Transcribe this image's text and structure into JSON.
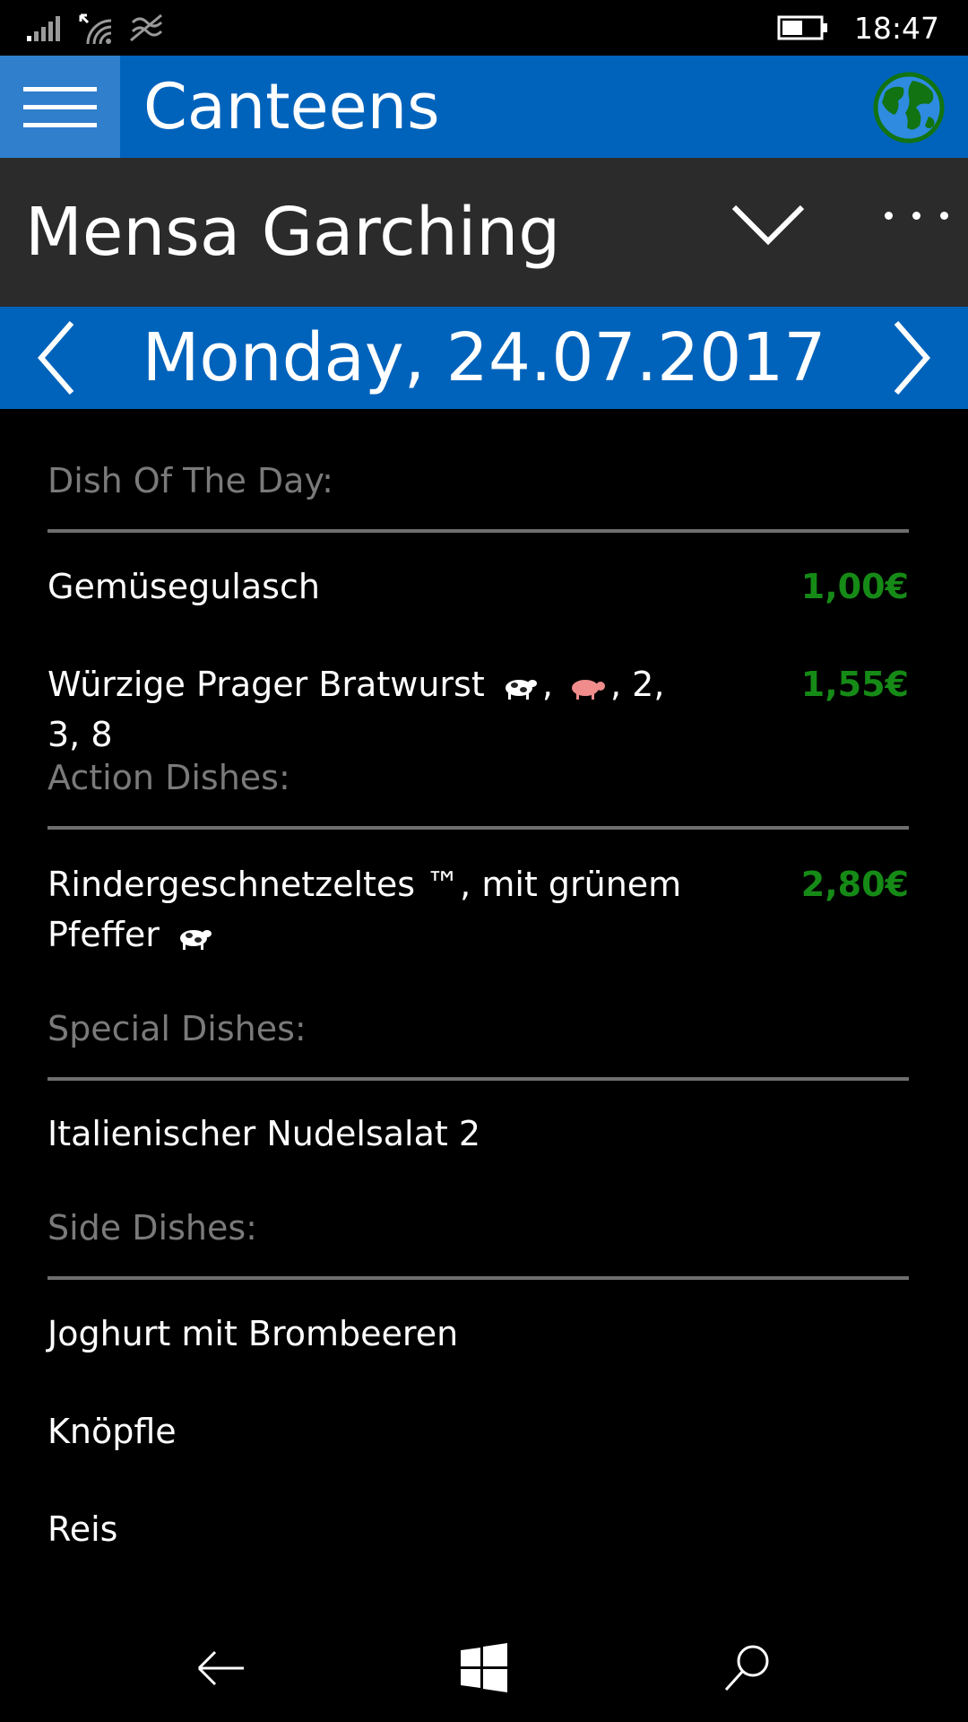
{
  "status_bar": {
    "time": "18:47",
    "icons": [
      "signal-icon",
      "wifi-icon",
      "data-icon",
      "battery-icon"
    ]
  },
  "app_bar": {
    "title": "Canteens",
    "menu_icon": "hamburger-icon",
    "action_icon": "globe-icon"
  },
  "canteen": {
    "name": "Mensa Garching"
  },
  "date_bar": {
    "date": "Monday, 24.07.2017"
  },
  "sections": [
    {
      "header": "Dish Of The Day:",
      "dishes": [
        {
          "name": "Gemüsegulasch",
          "price": "1,00€"
        },
        {
          "name": "Würzige Prager Bratwurst",
          "suffix": ", 2, 3, 8",
          "price": "1,55€"
        }
      ]
    },
    {
      "header": "Action Dishes:",
      "dishes": [
        {
          "name": "Rindergeschnetzeltes ™,  mit grünem Pfeffer",
          "price": "2,80€"
        }
      ]
    },
    {
      "header": "Special Dishes:",
      "dishes": [
        {
          "name": "Italienischer Nudelsalat 2"
        }
      ]
    },
    {
      "header": "Side Dishes:",
      "dishes": [
        {
          "name": "Joghurt mit Brombeeren"
        },
        {
          "name": "Knöpfle"
        },
        {
          "name": "Reis"
        }
      ]
    }
  ],
  "colors": {
    "accent_blue": "#0063BB",
    "hamburger_bg": "#2F7FCD",
    "selector_bg": "#2B2B2B",
    "price_green": "#168A16",
    "section_gray": "#7A7A7A"
  }
}
